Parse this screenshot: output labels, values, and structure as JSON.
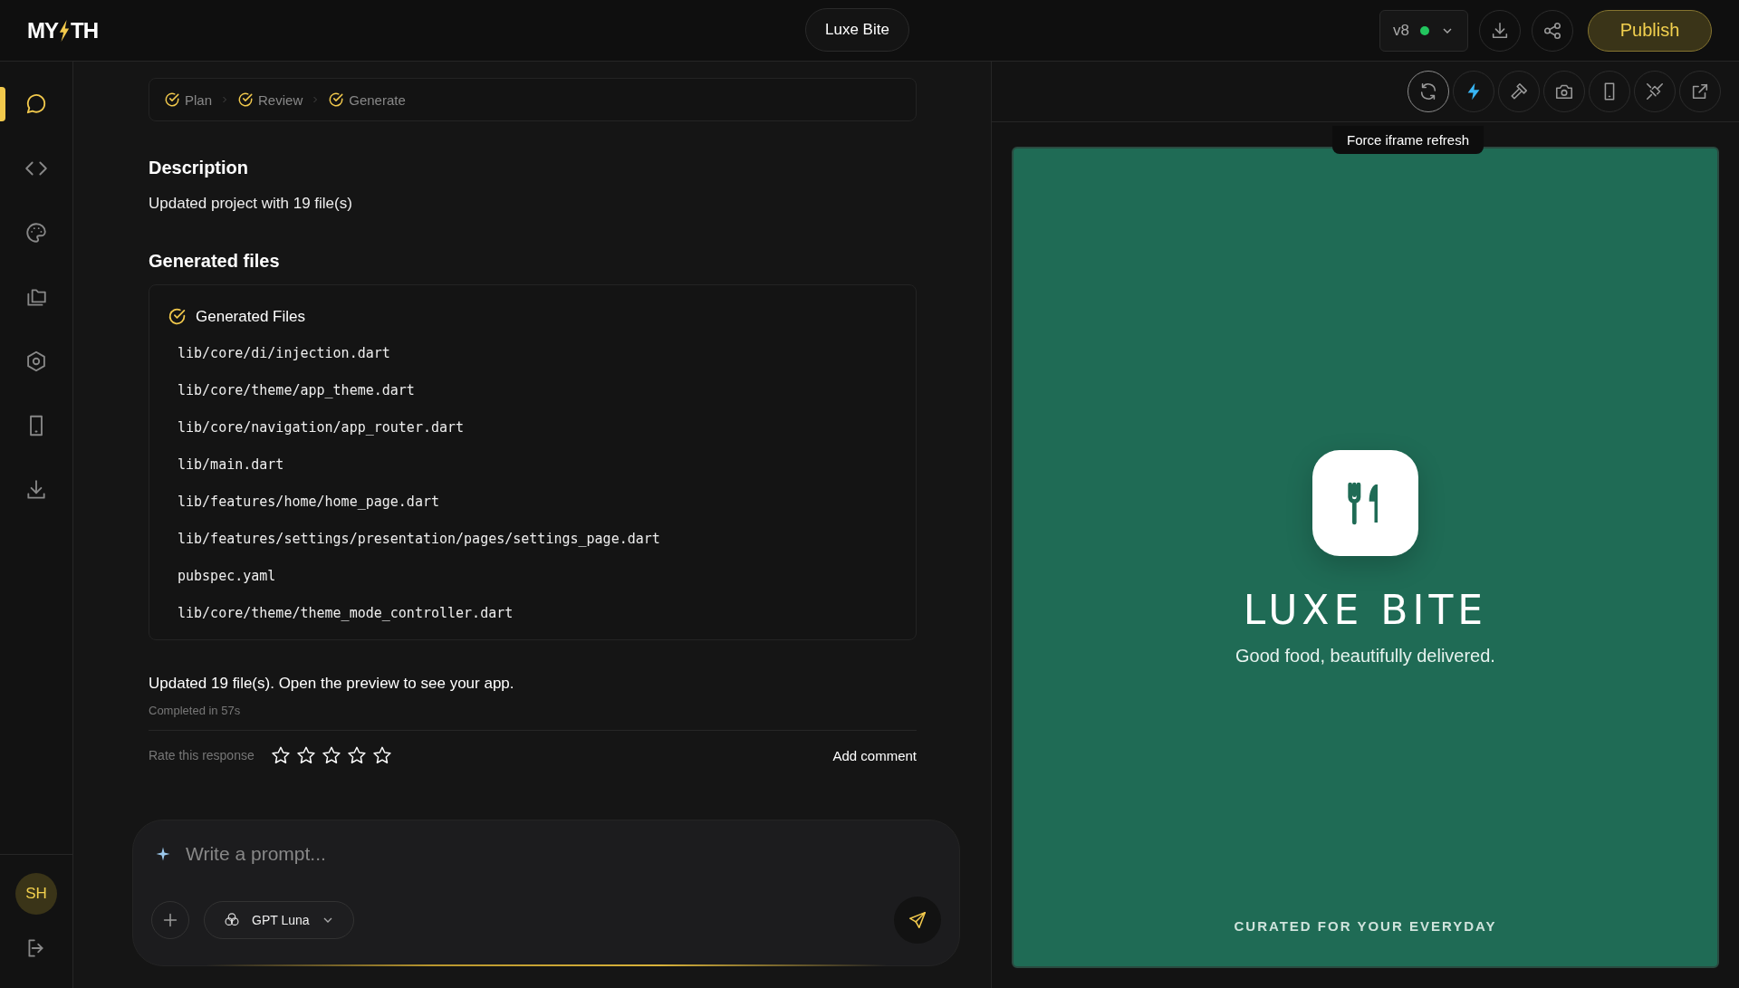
{
  "topbar": {
    "logo": {
      "before": "MY",
      "after": "TH"
    },
    "project_name": "Luxe Bite",
    "version": {
      "label": "v8",
      "live": true
    },
    "actions": [
      {
        "kind": "download"
      },
      {
        "kind": "share"
      }
    ],
    "publish": "Publish"
  },
  "sidebar": {
    "items": [
      {
        "kind": "chat",
        "selected": true
      },
      {
        "kind": "code",
        "selected": false
      },
      {
        "kind": "palette",
        "selected": false
      },
      {
        "kind": "folders",
        "selected": false
      },
      {
        "kind": "hexagon",
        "selected": false
      },
      {
        "kind": "tablet",
        "selected": false
      },
      {
        "kind": "download",
        "selected": false
      }
    ],
    "avatar": "SH"
  },
  "chat": {
    "steps": [
      {
        "label": "Plan",
        "done": true
      },
      {
        "label": "Review",
        "done": true
      },
      {
        "label": "Generate",
        "done": true
      }
    ],
    "description_heading": "Description",
    "description": "Updated project with 19 file(s)",
    "files_heading": "Generated files",
    "files_card_title": "Generated Files",
    "files": [
      "lib/core/di/injection.dart",
      "lib/core/theme/app_theme.dart",
      "lib/core/navigation/app_router.dart",
      "lib/main.dart",
      "lib/features/home/home_page.dart",
      "lib/features/settings/presentation/pages/settings_page.dart",
      "pubspec.yaml",
      "lib/core/theme/theme_mode_controller.dart"
    ],
    "summary": "Updated 19 file(s). Open the preview to see your app.",
    "completed": "Completed in 57s",
    "rating": {
      "label": "Rate this response",
      "stars": 0
    },
    "add_comment": "Add comment",
    "prompt": {
      "placeholder": "Write a prompt...",
      "model": "GPT Luna"
    }
  },
  "preview": {
    "tools": [
      {
        "kind": "refresh",
        "active": false,
        "hovered": true
      },
      {
        "kind": "bolt",
        "active": true,
        "hovered": false
      },
      {
        "kind": "hammer",
        "active": false,
        "hovered": false
      },
      {
        "kind": "camera",
        "active": false,
        "hovered": false
      },
      {
        "kind": "phone",
        "active": false,
        "hovered": false
      },
      {
        "kind": "unplug",
        "active": false,
        "hovered": false
      },
      {
        "kind": "external",
        "active": false,
        "hovered": false
      }
    ],
    "tooltip": "Force iframe refresh",
    "app": {
      "title": "LUXE BITE",
      "tagline": "Good food, beautifully delivered.",
      "footer": "CURATED FOR YOUR EVERYDAY"
    }
  }
}
